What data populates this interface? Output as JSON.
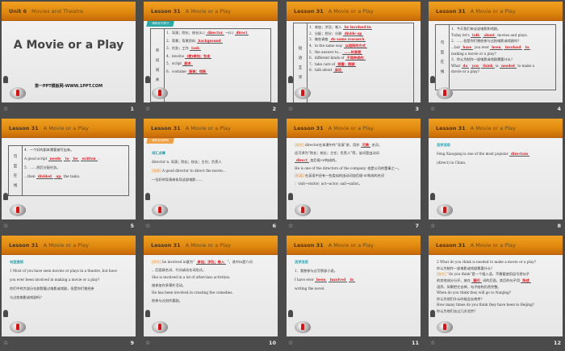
{
  "slides": [
    {
      "number": "1",
      "title_a": "Unit 6",
      "title_b": "Movies and Theatre",
      "main_title": "A Movie or a Play",
      "subtitle": "第一PPT模板网-WWW.1PPT.COM"
    },
    {
      "number": "2",
      "title_a": "Lesson 31",
      "title_b": "A Movie or a Play",
      "tag": "课前自主预习",
      "side": [
        "单",
        "词",
        "闯",
        "关"
      ],
      "lines": [
        [
          {
            "t": "1．导演；院长；校长(n.)"
          },
          {
            "t": "director",
            "r": 1
          },
          {
            "t": "→(v.)"
          },
          {
            "t": "direct",
            "r": 1
          }
        ],
        [
          {
            "t": "2．背景；背景资料"
          },
          {
            "t": "background",
            "r": 1
          }
        ],
        [
          {
            "t": "3．任务；工作"
          },
          {
            "t": "task",
            "r": 1
          }
        ],
        [
          {
            "t": "4．involve"
          },
          {
            "t": "(使)参加；包含",
            "r": 1
          }
        ],
        [
          {
            "t": "5．script"
          },
          {
            "t": "剧本",
            "r": 1
          }
        ],
        [
          {
            "t": "6．costume"
          },
          {
            "t": "服装；戏装",
            "r": 1
          }
        ]
      ]
    },
    {
      "number": "3",
      "title_a": "Lesson 31",
      "title_b": "A Movie or a Play",
      "side": [
        "短",
        "语",
        "互",
        "译"
      ],
      "lines": [
        [
          {
            "t": "1．参加；涉及；卷入"
          },
          {
            "t": "be involved in",
            "r": 1
          }
        ],
        [
          {
            "t": "2．分配；划分；分割"
          },
          {
            "t": "divide up",
            "r": 1
          }
        ],
        [
          {
            "t": "3．做些调查"
          },
          {
            "t": "do some research",
            "r": 1
          }
        ],
        [
          {
            "t": "4．in the same way"
          },
          {
            "t": "以相同的方式",
            "r": 1
          }
        ],
        [
          {
            "t": "5．the answer to..."
          },
          {
            "t": "……的答案",
            "r": 1
          }
        ],
        [
          {
            "t": "6．different kinds of"
          },
          {
            "t": "不同种类的",
            "r": 1
          }
        ],
        [
          {
            "t": "7．take care of"
          },
          {
            "t": "照看；照顾",
            "r": 1
          }
        ],
        [
          {
            "t": "8．talk about"
          },
          {
            "t": "谈论",
            "r": 1
          }
        ]
      ]
    },
    {
      "number": "4",
      "title_a": "Lesson 31",
      "title_b": "A Movie or a Play",
      "side": [
        "句",
        "型",
        "在",
        "线"
      ],
      "lines": [
        [
          {
            "t": "1．今天我们来谈谈电影和戏剧。"
          }
        ],
        [
          {
            "t": "Today let's"
          },
          {
            "t": "talk",
            "r": 1
          },
          {
            "t": "about",
            "r": 1
          },
          {
            "t": "movies and plays."
          }
        ],
        [
          {
            "t": "2．……但是你们曾经参与过拍电影或戏剧吗？"
          }
        ],
        [
          {
            "t": "...but"
          },
          {
            "t": "have",
            "r": 1
          },
          {
            "t": "you ever"
          },
          {
            "t": "been",
            "r": 1
          },
          {
            "t": "involved",
            "r": 1
          },
          {
            "t": "in",
            "r": 1
          }
        ],
        [
          {
            "t": "making a movie or a play?"
          }
        ],
        [
          {
            "t": "3．你认为制作一部电影或戏剧需要什么？"
          }
        ],
        [
          {
            "t": "What"
          },
          {
            "t": "do",
            "r": 1
          },
          {
            "t": "you",
            "r": 1
          },
          {
            "t": "think",
            "r": 1
          },
          {
            "t": "is"
          },
          {
            "t": "needed",
            "r": 1
          },
          {
            "t": "to make a"
          }
        ],
        [
          {
            "t": "movie or a play?"
          }
        ]
      ]
    },
    {
      "number": "5",
      "title_a": "Lesson 31",
      "title_b": "A Movie or a Play",
      "side": [
        "句",
        "型",
        "在",
        "线"
      ],
      "lines": [
        [
          {
            "t": "4．一个好的剧本需要被写出来。"
          }
        ],
        [
          {
            "t": "A good script"
          },
          {
            "t": "needs",
            "r": 1
          },
          {
            "t": "to",
            "r": 1
          },
          {
            "t": "be",
            "r": 1
          },
          {
            "t": "written",
            "r": 1
          },
          {
            "t": "."
          }
        ],
        [
          {
            "t": "5．……然后分配任务。"
          }
        ],
        [
          {
            "t": "...then"
          },
          {
            "t": "divided",
            "r": 1
          },
          {
            "t": "up",
            "r": 1
          },
          {
            "t": "the tasks."
          }
        ]
      ]
    },
    {
      "number": "6",
      "title_a": "Lesson 31",
      "title_b": "A Movie or a Play",
      "tag": "课堂互动探究",
      "tag_orange": 1,
      "lines": [
        [
          {
            "t": "词汇点睛",
            "c": "teal"
          }
        ],
        [
          {
            "t": "director n. 导演；院长；校长；主任；负责人"
          }
        ],
        [
          {
            "t": "[观察]",
            "c": "org"
          },
          {
            "t": " A good director to direct the movie..."
          }
        ],
        [
          {
            "t": "一位好的导演来执导这部电影……"
          }
        ]
      ]
    },
    {
      "number": "7",
      "title_a": "Lesson 31",
      "title_b": "A Movie or a Play",
      "lines": [
        [
          {
            "t": "[探究]",
            "c": "org"
          },
          {
            "t": " director在本课中作“导演”讲，用作"
          },
          {
            "t": "可数",
            "r": 1
          },
          {
            "t": "名词，"
          }
        ],
        [
          {
            "t": "还可译为“院长；校长；主任；负责人”等，该词是由动词"
          }
        ],
        [
          {
            "t": "direct",
            "r": 1
          },
          {
            "t": "加后缀-or构成的。"
          }
        ],
        [
          {
            "t": "He is one of the directors of the company. 他是公司的董事之一。"
          }
        ],
        [
          {
            "t": "[拓展]",
            "c": "org"
          },
          {
            "t": " 在英语中还有一些类似的由动词加后缀-or构成的名词"
          }
        ],
        [
          {
            "t": "：visit→visitor; act→actor; sail→sailor。"
          }
        ]
      ]
    },
    {
      "number": "8",
      "title_a": "Lesson 31",
      "title_b": "A Movie or a Play",
      "lines": [
        [
          {
            "t": "活学活用",
            "c": "teal"
          }
        ],
        [
          {
            "t": "Feng Xiaogang is one of the most popular"
          },
          {
            "t": "directors",
            "r": 1
          }
        ],
        [
          {
            "t": "(direct) in China."
          }
        ]
      ]
    },
    {
      "number": "9",
      "title_a": "Lesson 31",
      "title_b": "A Movie or a Play",
      "lines": [
        [
          {
            "t": "句型透视",
            "c": "teal"
          }
        ],
        [
          {
            "t": "1  Most of you have seen movies or plays in a theatre, but have"
          }
        ],
        [
          {
            "t": "you ever been involved in making a movie or a play?"
          }
        ],
        [
          {
            "t": "    你们中的大部分在剧院看过电影或戏剧，但是你们曾经参"
          }
        ],
        [
          {
            "t": "与过拍电影或戏剧吗？"
          }
        ]
      ]
    },
    {
      "number": "10",
      "title_a": "Lesson 31",
      "title_b": "A Movie or a Play",
      "lines": [
        [
          {
            "t": "[探究]",
            "c": "org"
          },
          {
            "t": " be involved in意为“"
          },
          {
            "t": "参加；涉及；卷入",
            "r": 1
          },
          {
            "t": "”，其中in是介词"
          }
        ],
        [
          {
            "t": "，后面接名词、代词或动名词形式。"
          }
        ],
        [
          {
            "t": "She is involved in a lot of afterclass activities."
          }
        ],
        [
          {
            "t": "她参加许多课外活动。"
          }
        ],
        [
          {
            "t": "He has been involved in creating the comedies."
          }
        ],
        [
          {
            "t": "他参与过创作喜剧。"
          }
        ]
      ]
    },
    {
      "number": "11",
      "title_a": "Lesson 31",
      "title_b": "A Movie or a Play",
      "lines": [
        [
          {
            "t": "活学活用",
            "c": "teal"
          }
        ],
        [
          {
            "t": "1．我曾参与过写那部小说。"
          }
        ],
        [
          {
            "t": "    I have ever"
          },
          {
            "t": "been",
            "r": 1
          },
          {
            "t": "involved",
            "r": 1
          },
          {
            "t": "in",
            "r": 1
          }
        ],
        [
          {
            "t": "writing the novel."
          }
        ]
      ]
    },
    {
      "number": "12",
      "title_a": "Lesson 31",
      "title_b": "A Movie or a Play",
      "lines": [
        [
          {
            "t": "2  What do you think is needed to make a movie or a play?"
          }
        ],
        [
          {
            "t": "   你认为制作一部电影或戏剧需要什么？"
          }
        ],
        [
          {
            "t": "[探究]",
            "c": "org"
          },
          {
            "t": "“do you think”是一个插入语，不需要使用逗号把句子"
          }
        ],
        [
          {
            "t": "的其他成分分开，放在"
          },
          {
            "t": "疑问",
            "r": 1
          },
          {
            "t": "词的后面，其后的句子用"
          },
          {
            "t": "陈述",
            "r": 1
          }
        ],
        [
          {
            "t": "语序。如果把它去掉，句子结构仍然完整。"
          }
        ],
        [
          {
            "t": "When do you think they will go to Nanjing?"
          }
        ],
        [
          {
            "t": "你认为他们什么时候会去南京？"
          }
        ],
        [
          {
            "t": "How many times do you think they have been to Beijing?"
          }
        ],
        [
          {
            "t": "你认为他们去过几次北京？"
          }
        ]
      ]
    }
  ]
}
